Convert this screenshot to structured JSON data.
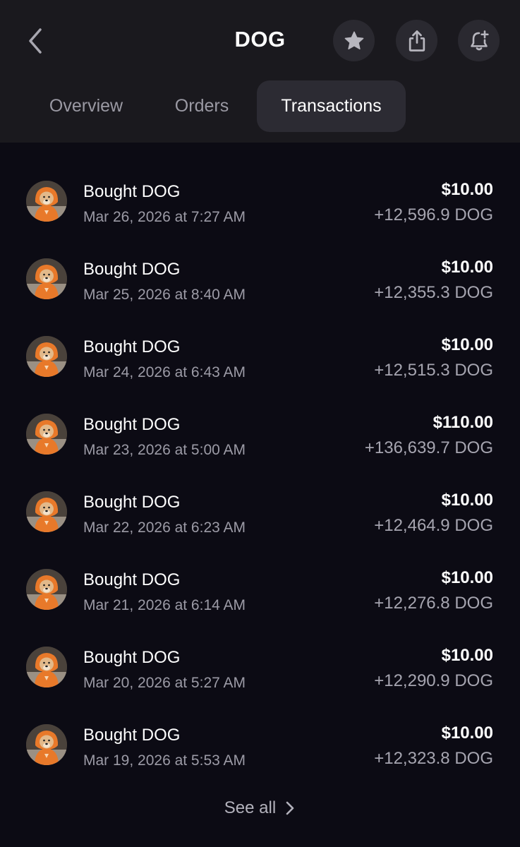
{
  "header": {
    "title": "DOG",
    "back_icon": "chevron-left-icon",
    "actions": [
      {
        "name": "star-icon"
      },
      {
        "name": "share-icon"
      },
      {
        "name": "bell-plus-icon"
      }
    ]
  },
  "tabs": [
    {
      "label": "Overview",
      "active": false
    },
    {
      "label": "Orders",
      "active": false
    },
    {
      "label": "Transactions",
      "active": true
    }
  ],
  "transactions": [
    {
      "title": "Bought DOG",
      "date": "Mar 26, 2026 at 7:27 AM",
      "usd": "$10.00",
      "amount": "+12,596.9 DOG"
    },
    {
      "title": "Bought DOG",
      "date": "Mar 25, 2026 at 8:40 AM",
      "usd": "$10.00",
      "amount": "+12,355.3 DOG"
    },
    {
      "title": "Bought DOG",
      "date": "Mar 24, 2026 at 6:43 AM",
      "usd": "$10.00",
      "amount": "+12,515.3 DOG"
    },
    {
      "title": "Bought DOG",
      "date": "Mar 23, 2026 at 5:00 AM",
      "usd": "$110.00",
      "amount": "+136,639.7 DOG"
    },
    {
      "title": "Bought DOG",
      "date": "Mar 22, 2026 at 6:23 AM",
      "usd": "$10.00",
      "amount": "+12,464.9 DOG"
    },
    {
      "title": "Bought DOG",
      "date": "Mar 21, 2026 at 6:14 AM",
      "usd": "$10.00",
      "amount": "+12,276.8 DOG"
    },
    {
      "title": "Bought DOG",
      "date": "Mar 20, 2026 at 5:27 AM",
      "usd": "$10.00",
      "amount": "+12,290.9 DOG"
    },
    {
      "title": "Bought DOG",
      "date": "Mar 19, 2026 at 5:53 AM",
      "usd": "$10.00",
      "amount": "+12,323.8 DOG"
    }
  ],
  "see_all": {
    "label": "See all",
    "icon": "chevron-right-icon"
  },
  "colors": {
    "background": "#0c0b14",
    "header_background": "#1a191e",
    "active_tab": "#2c2b33",
    "icon_button": "#2a2930",
    "secondary_text": "#9c9ba6",
    "avatar_orange": "#e8792a"
  }
}
